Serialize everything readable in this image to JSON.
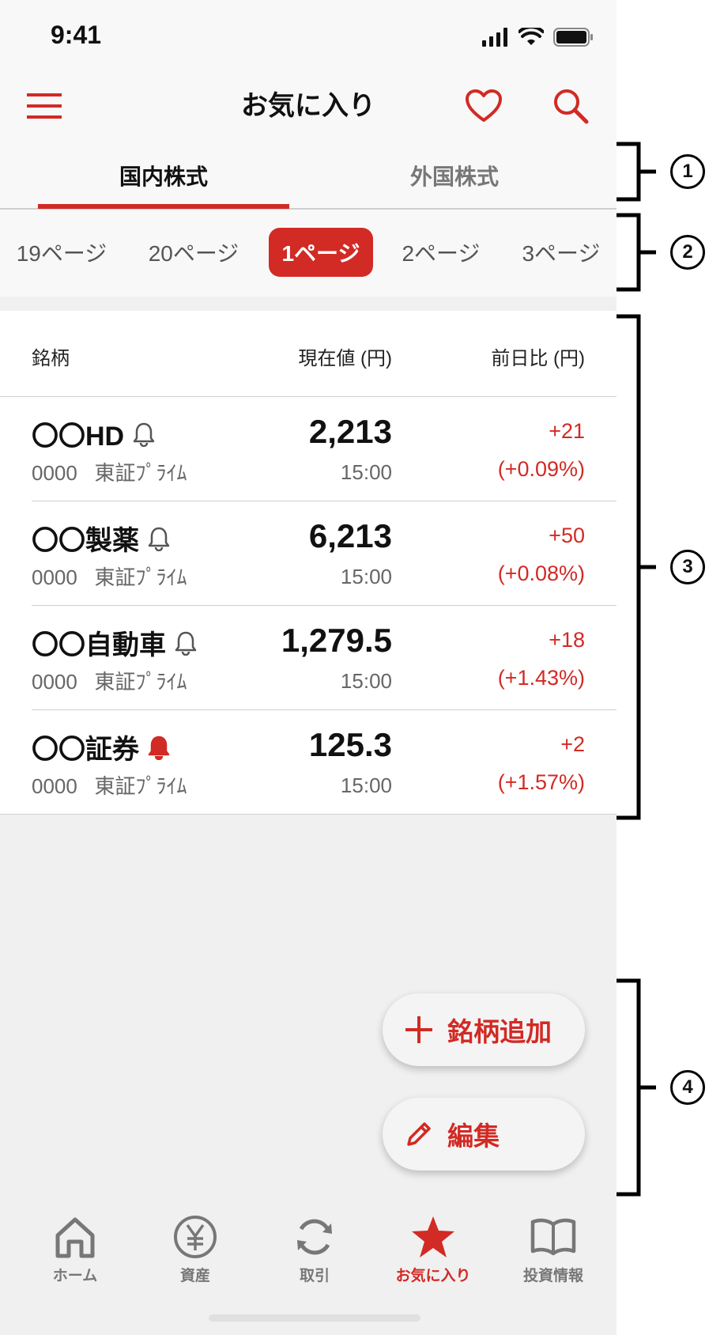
{
  "status": {
    "time": "9:41"
  },
  "header": {
    "title": "お気に入り"
  },
  "tabs": [
    {
      "label": "国内株式",
      "active": true
    },
    {
      "label": "外国株式",
      "active": false
    }
  ],
  "pages": [
    "19ページ",
    "20ページ",
    "1ページ",
    "2ページ",
    "3ページ"
  ],
  "pages_active": "1ページ",
  "table": {
    "headers": {
      "name": "銘柄",
      "price": "現在値 (円)",
      "change": "前日比 (円)"
    },
    "rows": [
      {
        "name": "〇〇HD",
        "code": "0000",
        "market": "東証ﾌﾟﾗｲﾑ",
        "price": "2,213",
        "time": "15:00",
        "change": "+21",
        "change_pct": "(+0.09%)",
        "alert_icon": "bell-outline-icon"
      },
      {
        "name": "〇〇製薬",
        "code": "0000",
        "market": "東証ﾌﾟﾗｲﾑ",
        "price": "6,213",
        "time": "15:00",
        "change": "+50",
        "change_pct": "(+0.08%)",
        "alert_icon": "bell-outline-icon"
      },
      {
        "name": "〇〇自動車",
        "code": "0000",
        "market": "東証ﾌﾟﾗｲﾑ",
        "price": "1,279.5",
        "time": "15:00",
        "change": "+18",
        "change_pct": "(+1.43%)",
        "alert_icon": "bell-outline-icon"
      },
      {
        "name": "〇〇証券",
        "code": "0000",
        "market": "東証ﾌﾟﾗｲﾑ",
        "price": "125.3",
        "time": "15:00",
        "change": "+2",
        "change_pct": "(+1.57%)",
        "alert_icon": "bell-filled-icon"
      }
    ]
  },
  "fab": {
    "add_label": "銘柄追加",
    "edit_label": "編集"
  },
  "nav": [
    {
      "label": "ホーム",
      "icon": "home-icon"
    },
    {
      "label": "資産",
      "icon": "yen-icon"
    },
    {
      "label": "取引",
      "icon": "refresh-icon"
    },
    {
      "label": "お気に入り",
      "icon": "star-icon",
      "active": true
    },
    {
      "label": "投資情報",
      "icon": "book-icon"
    }
  ],
  "annotations": [
    "1",
    "2",
    "3",
    "4"
  ],
  "colors": {
    "accent": "#d22a24",
    "background": "#f0f0f0",
    "surface": "#ffffff"
  }
}
